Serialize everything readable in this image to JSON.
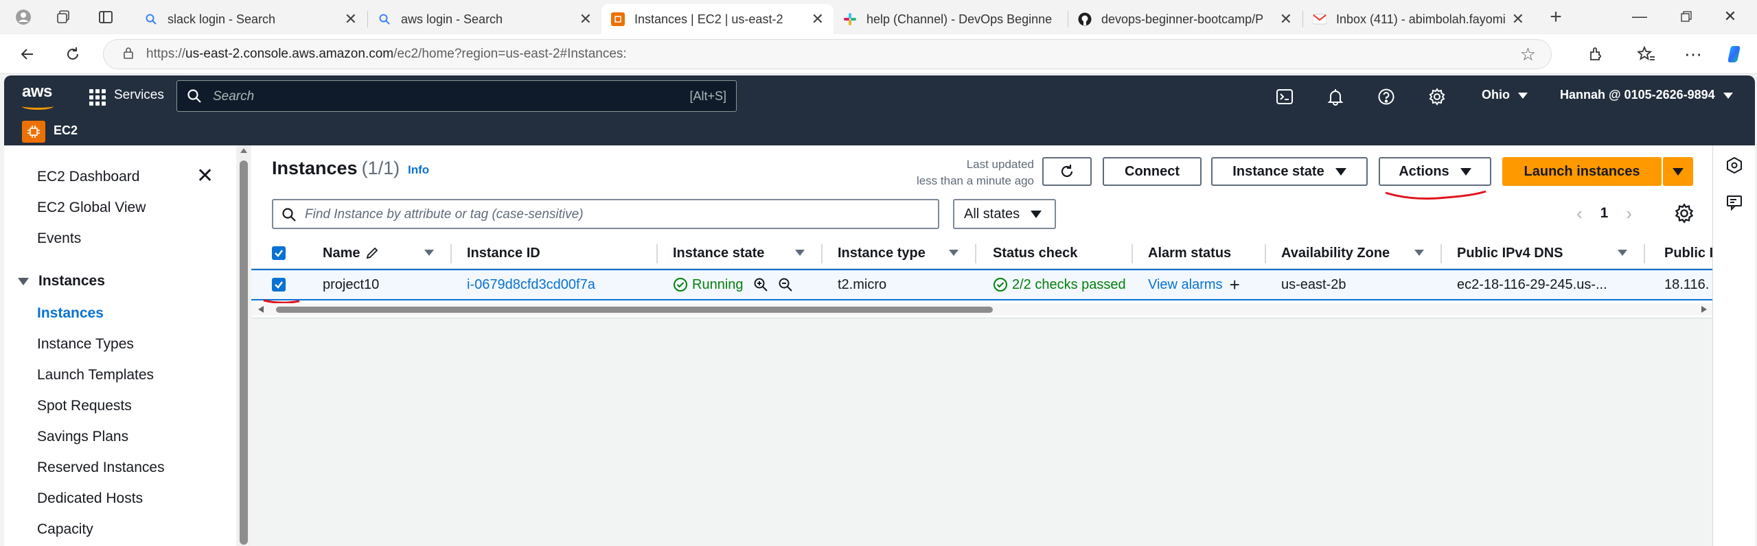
{
  "browser": {
    "tabs": [
      {
        "title": "slack login - Search",
        "icon": "search-icon"
      },
      {
        "title": "aws login - Search",
        "icon": "search-icon"
      },
      {
        "title": "Instances | EC2 | us-east-2",
        "icon": "aws-ec2-icon"
      },
      {
        "title": "help (Channel) - DevOps Beginne",
        "icon": "slack-icon"
      },
      {
        "title": "devops-beginner-bootcamp/P",
        "icon": "github-icon"
      },
      {
        "title": "Inbox (411) - abimbolah.fayomi",
        "icon": "gmail-icon"
      }
    ],
    "url_prefix": "https://",
    "url_host": "us-east-2.console.aws.amazon.com",
    "url_path": "/ec2/home?region=us-east-2#Instances:"
  },
  "aws": {
    "logo": "aws",
    "services_label": "Services",
    "search_placeholder": "Search",
    "search_shortcut": "[Alt+S]",
    "region": "Ohio",
    "account": "Hannah @ 0105-2626-9894",
    "service_name": "EC2"
  },
  "sidebar": {
    "items": [
      {
        "label": "EC2 Dashboard"
      },
      {
        "label": "EC2 Global View"
      },
      {
        "label": "Events"
      }
    ],
    "section": "Instances",
    "sub_items": [
      {
        "label": "Instances",
        "active": true
      },
      {
        "label": "Instance Types"
      },
      {
        "label": "Launch Templates"
      },
      {
        "label": "Spot Requests"
      },
      {
        "label": "Savings Plans"
      },
      {
        "label": "Reserved Instances"
      },
      {
        "label": "Dedicated Hosts"
      },
      {
        "label": "Capacity"
      }
    ]
  },
  "main": {
    "title": "Instances",
    "count": "(1/1)",
    "info": "Info",
    "last_updated_line1": "Last updated",
    "last_updated_line2": "less than a minute ago",
    "buttons": {
      "connect": "Connect",
      "instance_state": "Instance state",
      "actions": "Actions",
      "launch": "Launch instances"
    },
    "filter_placeholder": "Find Instance by attribute or tag (case-sensitive)",
    "state_filter": "All states",
    "page": "1",
    "columns": [
      "Name",
      "Instance ID",
      "Instance state",
      "Instance type",
      "Status check",
      "Alarm status",
      "Availability Zone",
      "Public IPv4 DNS",
      "Public I"
    ],
    "row": {
      "name": "project10",
      "instance_id": "i-0679d8cfd3cd00f7a",
      "state": "Running",
      "type": "t2.micro",
      "status_check": "2/2 checks passed",
      "alarm": "View alarms",
      "az": "us-east-2b",
      "dns": "ec2-18-116-29-245.us-...",
      "ip": "18.116."
    }
  },
  "colors": {
    "aws_nav": "#232f3e",
    "accent_orange": "#ff9900",
    "link_blue": "#0972d3",
    "success_green": "#037f0c",
    "annotation_red": "#e0141e"
  }
}
